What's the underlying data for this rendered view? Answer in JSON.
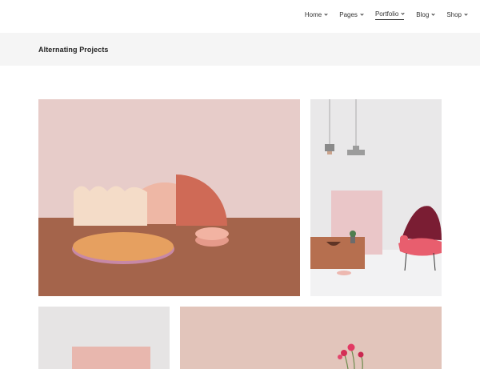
{
  "nav": {
    "items": [
      {
        "label": "Home",
        "active": false
      },
      {
        "label": "Pages",
        "active": false
      },
      {
        "label": "Portfolio",
        "active": true
      },
      {
        "label": "Blog",
        "active": false
      },
      {
        "label": "Shop",
        "active": false
      }
    ]
  },
  "page": {
    "title": "Alternating Projects"
  },
  "projects": [
    {
      "image": "pastel-geometric-shapes-still-life"
    },
    {
      "image": "pink-chair-pendant-lamps-interior"
    },
    {
      "image": "pink-panel-on-white-wall"
    },
    {
      "image": "pink-flowers-on-beige-background"
    }
  ],
  "colors": {
    "title_bar_bg": "#f5f5f5",
    "accent_terracotta": "#a4644b",
    "blush": "#e5c5bf"
  }
}
